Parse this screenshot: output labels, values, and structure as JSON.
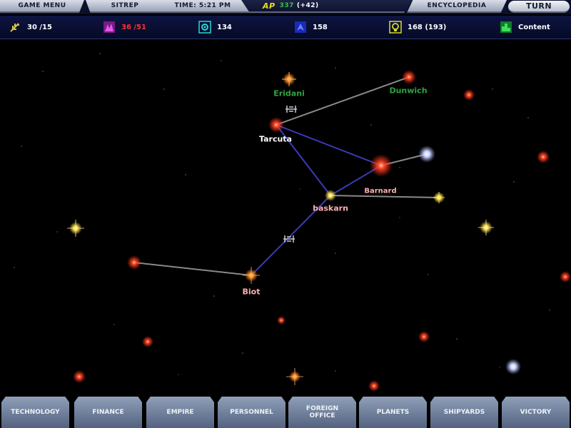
{
  "topbar": {
    "game_menu": "Game Menu",
    "sitrep": "Sitrep",
    "time": "Time: 5:21 PM",
    "ap_logo": "AP",
    "ap_value": "337",
    "ap_delta": "(+42)",
    "encyclopedia": "Encyclopedia",
    "turn": "Turn"
  },
  "stats": [
    {
      "name": "food",
      "value": "30 /15",
      "color": "#ffffff",
      "icon_color": "#d9c84a"
    },
    {
      "name": "industry",
      "value": "36 /51",
      "color": "#ff3030",
      "icon_color": "#c23ad9"
    },
    {
      "name": "research",
      "value": "134",
      "color": "#ffffff",
      "icon_color": "#2ad6d6"
    },
    {
      "name": "ships",
      "value": "158",
      "color": "#ffffff",
      "icon_color": "#3a52ff"
    },
    {
      "name": "income",
      "value": "168 (193)",
      "color": "#ffffff",
      "icon_color": "#d9d92a"
    },
    {
      "name": "morale",
      "value": "Content",
      "color": "#ffffff",
      "icon_color": "#2ad64a"
    }
  ],
  "systems": [
    {
      "id": "tarcuta",
      "label": "Tarcuta",
      "label_color": "#ffffff",
      "star_color": "#ff4a2a"
    },
    {
      "id": "eridani",
      "label": "Eridani",
      "label_color": "#2fa640",
      "star_color": "#ff9a2a"
    },
    {
      "id": "dunwich",
      "label": "Dunwich",
      "label_color": "#2fa640",
      "star_color": "#ff3a2a"
    },
    {
      "id": "baskarn",
      "label": "baskarn",
      "label_color": "#ffb0b0",
      "star_color": "#ffe03a"
    },
    {
      "id": "barnard",
      "label": "Barnard",
      "label_color": "#ffb0b0",
      "star_color": "#ffe03a"
    },
    {
      "id": "biot",
      "label": "Biot",
      "label_color": "#ffb0b0",
      "star_color": "#ff8a2a"
    }
  ],
  "nav": [
    {
      "id": "technology",
      "label": "Technology"
    },
    {
      "id": "finance",
      "label": "Finance"
    },
    {
      "id": "empire",
      "label": "Empire"
    },
    {
      "id": "personnel",
      "label": "Personnel"
    },
    {
      "id": "foreign-office",
      "label": "Foreign Office"
    },
    {
      "id": "planets",
      "label": "Planets"
    },
    {
      "id": "shipyards",
      "label": "Shipyards"
    },
    {
      "id": "victory",
      "label": "Victory"
    }
  ],
  "colors": {
    "lane_owned": "#3a3ab8",
    "lane_unowned": "#8a8a8a",
    "ui_panel": "#0b0f2e"
  }
}
